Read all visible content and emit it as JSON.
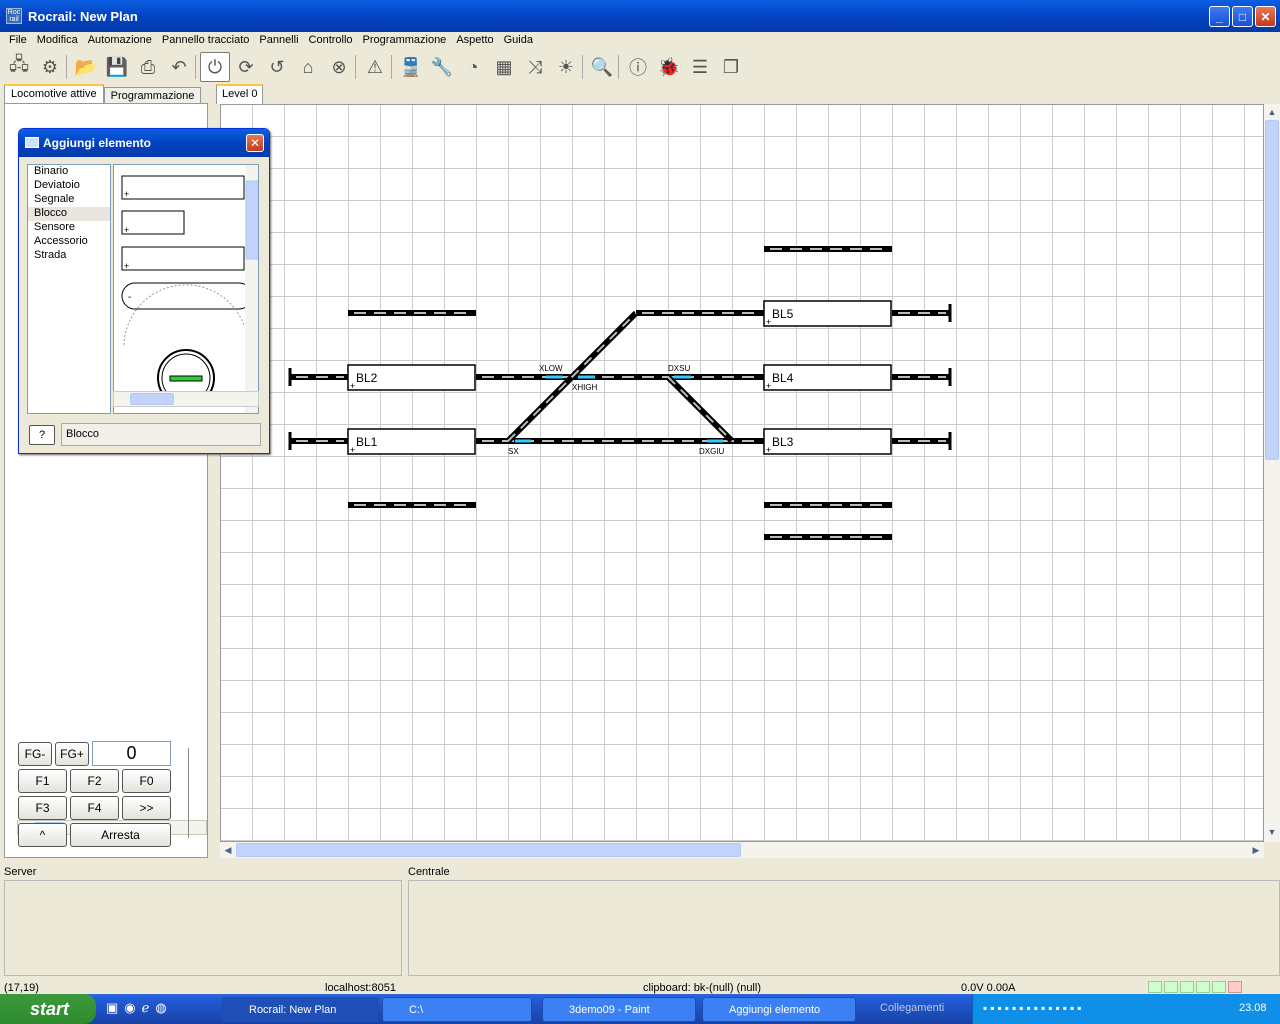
{
  "window": {
    "title": "Rocrail: New Plan",
    "icon": "rocrail-icon"
  },
  "menu": [
    "File",
    "Modifica",
    "Automazione",
    "Pannello tracciato",
    "Pannelli",
    "Controllo",
    "Programmazione",
    "Aspetto",
    "Guida"
  ],
  "toolbar": {
    "icons": [
      "network-icon",
      "gear-icon",
      "open-folder-icon",
      "save-icon",
      "print-icon",
      "undo-icon",
      "power-icon",
      "refresh-icon",
      "rotate-icon",
      "home-icon",
      "stop-icon",
      "warning-icon",
      "train-icon",
      "wrench-icon",
      "speedometer-icon",
      "grid-icon",
      "shuffle-icon",
      "light-icon",
      "zoom-icon",
      "info-icon",
      "bug-icon",
      "list-icon",
      "pages-icon"
    ]
  },
  "left": {
    "tabs": [
      "Locomotive attive",
      "Programmazione"
    ],
    "controls": {
      "fg_minus": "FG-",
      "fg_plus": "FG+",
      "speed": "0",
      "f1": "F1",
      "f2": "F2",
      "f0": "F0",
      "f3": "F3",
      "f4": "F4",
      "more": ">>",
      "up": "^",
      "stop": "Arresta"
    }
  },
  "plan": {
    "tab": "Level 0",
    "blocks": [
      {
        "id": "BL5"
      },
      {
        "id": "BL2"
      },
      {
        "id": "BL4"
      },
      {
        "id": "BL1"
      },
      {
        "id": "BL3"
      }
    ],
    "switches": [
      {
        "id": "XLOW"
      },
      {
        "id": "XHIGH"
      },
      {
        "id": "DXSU"
      },
      {
        "id": "SX"
      },
      {
        "id": "DXGIU"
      }
    ]
  },
  "dialog": {
    "title": "Aggiungi elemento",
    "items": [
      "Binario",
      "Deviatoio",
      "Segnale",
      "Blocco",
      "Sensore",
      "Accessorio",
      "Strada"
    ],
    "selected": "Blocco",
    "help": "?",
    "status": "Blocco"
  },
  "bottom": {
    "server_label": "Server",
    "centrale_label": "Centrale"
  },
  "status": {
    "coords": "(17,19)",
    "host": "localhost:8051",
    "clipboard": "clipboard: bk-(null) (null)",
    "power": "0.0V 0.00A"
  },
  "taskbar": {
    "start": "start",
    "tasks": [
      "Rocrail: New Plan",
      "C:\\",
      "3demo09 - Paint",
      "Aggiungi elemento"
    ],
    "links": "Collegamenti",
    "time": "23.08"
  }
}
